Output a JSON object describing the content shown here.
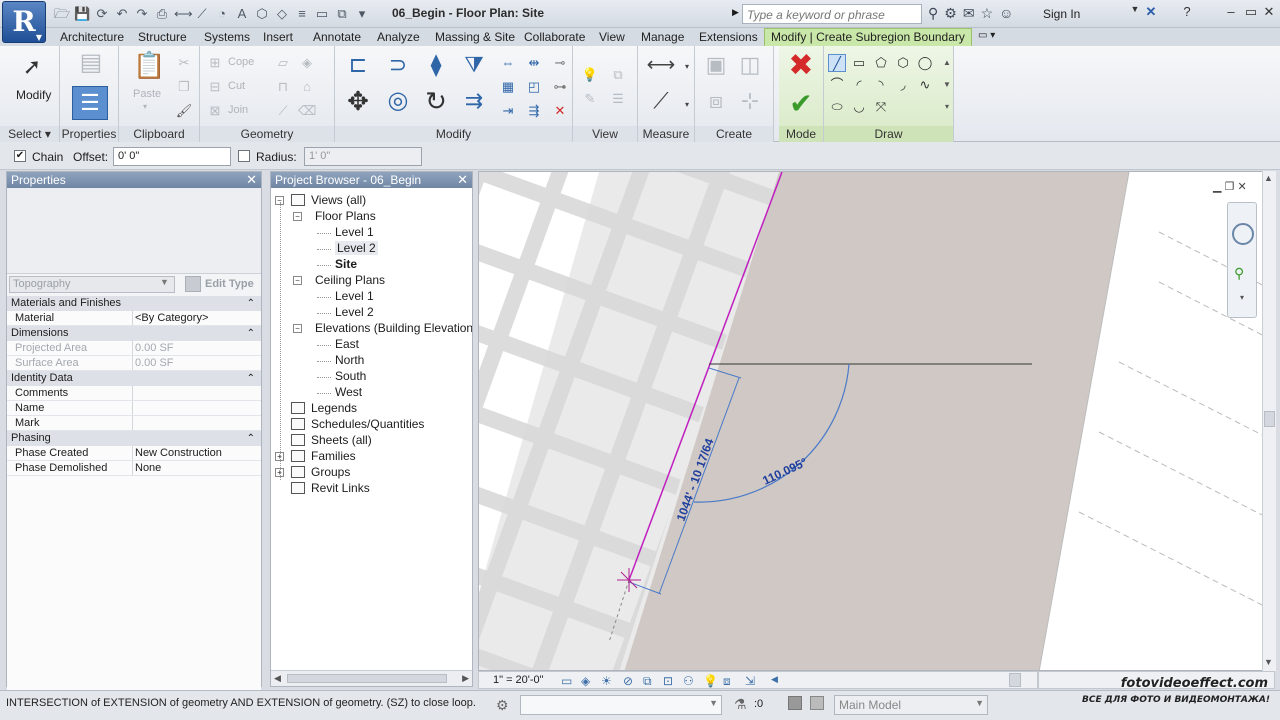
{
  "app": {
    "logo_letter": "R",
    "document_title": "06_Begin - Floor Plan: Site",
    "search_placeholder": "Type a keyword or phrase",
    "sign_in": "Sign In"
  },
  "ribbon_tabs": [
    "Architecture",
    "Structure",
    "Systems",
    "Insert",
    "Annotate",
    "Analyze",
    "Massing & Site",
    "Collaborate",
    "View",
    "Manage",
    "Extensions",
    "Modify | Create Subregion Boundary"
  ],
  "ribbon": {
    "modify_label": "Modify",
    "paste_label": "Paste",
    "geometry_items": [
      "Cope",
      "Cut",
      "Join"
    ],
    "panels": {
      "select": "Select",
      "properties": "Properties",
      "clipboard": "Clipboard",
      "geometry": "Geometry",
      "modify": "Modify",
      "view": "View",
      "measure": "Measure",
      "create": "Create",
      "mode": "Mode",
      "draw": "Draw"
    }
  },
  "options_bar": {
    "chain_label": "Chain",
    "chain_checked": true,
    "offset_label": "Offset:",
    "offset_value": "0'  0\"",
    "radius_label": "Radius:",
    "radius_value": "1'  0\"",
    "radius_checked": false
  },
  "properties": {
    "title": "Properties",
    "type_value": "Topography",
    "edit_type": "Edit Type",
    "sections": [
      {
        "name": "Materials and Finishes",
        "rows": [
          {
            "k": "Material",
            "v": "<By Category>",
            "dis": false
          }
        ]
      },
      {
        "name": "Dimensions",
        "rows": [
          {
            "k": "Projected Area",
            "v": "0.00 SF",
            "dis": true
          },
          {
            "k": "Surface Area",
            "v": "0.00 SF",
            "dis": true
          }
        ]
      },
      {
        "name": "Identity Data",
        "rows": [
          {
            "k": "Comments",
            "v": "",
            "dis": false
          },
          {
            "k": "Name",
            "v": "",
            "dis": false
          },
          {
            "k": "Mark",
            "v": "",
            "dis": false
          }
        ]
      },
      {
        "name": "Phasing",
        "rows": [
          {
            "k": "Phase Created",
            "v": "New Construction",
            "dis": false
          },
          {
            "k": "Phase Demolished",
            "v": "None",
            "dis": false
          }
        ]
      }
    ]
  },
  "browser": {
    "title": "Project Browser - 06_Begin",
    "nodes": [
      {
        "label": "Views (all)",
        "level": 0,
        "exp": "-",
        "icon": true
      },
      {
        "label": "Floor Plans",
        "level": 1,
        "exp": "-"
      },
      {
        "label": "Level 1",
        "level": 2
      },
      {
        "label": "Level 2",
        "level": 2,
        "sel": true
      },
      {
        "label": "Site",
        "level": 2,
        "bold": true
      },
      {
        "label": "Ceiling Plans",
        "level": 1,
        "exp": "-"
      },
      {
        "label": "Level 1",
        "level": 2
      },
      {
        "label": "Level 2",
        "level": 2
      },
      {
        "label": "Elevations (Building Elevation",
        "level": 1,
        "exp": "-"
      },
      {
        "label": "East",
        "level": 2
      },
      {
        "label": "North",
        "level": 2
      },
      {
        "label": "South",
        "level": 2
      },
      {
        "label": "West",
        "level": 2
      },
      {
        "label": "Legends",
        "level": 0,
        "icon": true
      },
      {
        "label": "Schedules/Quantities",
        "level": 0,
        "icon": true
      },
      {
        "label": "Sheets (all)",
        "level": 0,
        "icon": true
      },
      {
        "label": "Families",
        "level": 0,
        "exp": "+",
        "icon": true
      },
      {
        "label": "Groups",
        "level": 0,
        "exp": "+",
        "icon": true
      },
      {
        "label": "Revit Links",
        "level": 0,
        "icon": true
      }
    ]
  },
  "canvas": {
    "dimension_text": "1044' - 10 17/64",
    "angle_text": "110.095°"
  },
  "view_control": {
    "scale": "1\" = 20'-0\""
  },
  "status": {
    "text": "INTERSECTION  of EXTENSION  of geometry AND EXTENSION  of geometry.  (SZ) to close loop.",
    "filter_count": ":0",
    "model": "Main Model"
  },
  "watermark": {
    "line1": "fotovideoeffect.com",
    "line2": "ВСЕ ДЛЯ ФОТО И ВИДЕОМОНТАЖА!"
  }
}
